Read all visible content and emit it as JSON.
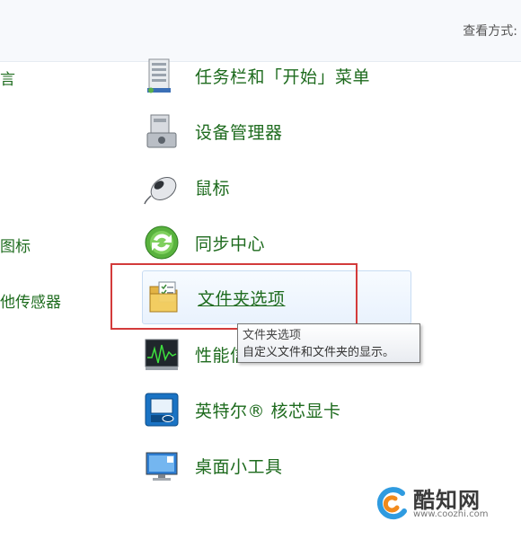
{
  "header": {
    "view_mode_label": "查看方式:"
  },
  "left_column": [
    {
      "label": "言"
    },
    {
      "label": "图标"
    },
    {
      "label": "他传感器"
    }
  ],
  "items": [
    {
      "label": "任务栏和「开始」菜单",
      "icon": "taskbar-icon"
    },
    {
      "label": "设备管理器",
      "icon": "device-manager-icon"
    },
    {
      "label": "鼠标",
      "icon": "mouse-icon"
    },
    {
      "label": "同步中心",
      "icon": "sync-center-icon"
    },
    {
      "label": "文件夹选项",
      "icon": "folder-options-icon"
    },
    {
      "label": "性能信",
      "icon": "performance-icon"
    },
    {
      "label": "英特尔® 核芯显卡",
      "icon": "intel-graphics-icon"
    },
    {
      "label": "桌面小工具",
      "icon": "desktop-gadgets-icon"
    }
  ],
  "tooltip": {
    "title": "文件夹选项",
    "description": "自定义文件和文件夹的显示。"
  },
  "watermark": {
    "name": "酷知网",
    "url": "www.coozhi.com"
  },
  "colors": {
    "link_green": "#1e6b1e",
    "highlight_red": "#d33b3b"
  }
}
